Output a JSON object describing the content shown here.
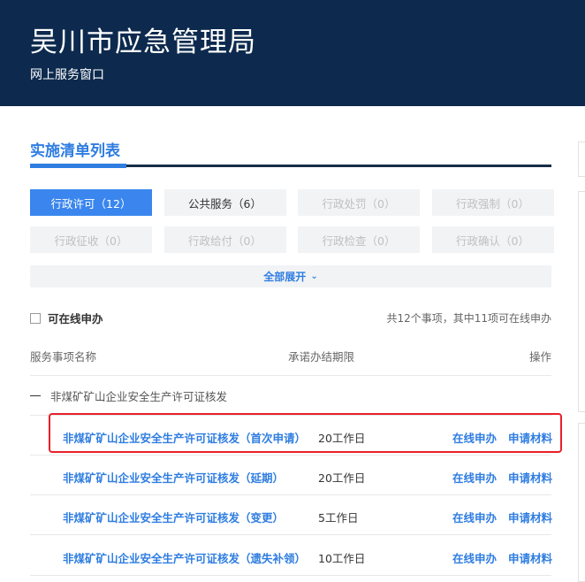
{
  "header": {
    "title": "吴川市应急管理局",
    "subtitle": "网上服务窗口",
    "bg_color": "#0d2a4e"
  },
  "section": {
    "title": "实施清单列表",
    "accent_color": "#2f7de1"
  },
  "categories": [
    {
      "label": "行政许可（12）",
      "state": "active"
    },
    {
      "label": "公共服务（6）",
      "state": "enabled"
    },
    {
      "label": "行政处罚（0）",
      "state": "disabled"
    },
    {
      "label": "行政强制（0）",
      "state": "disabled"
    },
    {
      "label": "行政征收（0）",
      "state": "disabled"
    },
    {
      "label": "行政给付（0）",
      "state": "disabled"
    },
    {
      "label": "行政检查（0）",
      "state": "disabled"
    },
    {
      "label": "行政确认（0）",
      "state": "disabled"
    }
  ],
  "expand": {
    "label": "全部展开",
    "icon": "chevron-down-icon"
  },
  "filter": {
    "label": "可在线申办",
    "checked": false
  },
  "summary": "共12个事项，其中11项可在线申办",
  "table": {
    "headers": {
      "name": "服务事项名称",
      "time": "承诺办结期限",
      "op": "操作"
    },
    "group": "非煤矿矿山企业安全生产许可证核发",
    "rows": [
      {
        "name": "非煤矿矿山企业安全生产许可证核发（首次申请）",
        "time": "20工作日",
        "online": "在线申办",
        "materials": "申请材料"
      },
      {
        "name": "非煤矿矿山企业安全生产许可证核发（延期）",
        "time": "20工作日",
        "online": "在线申办",
        "materials": "申请材料"
      },
      {
        "name": "非煤矿矿山企业安全生产许可证核发（变更）",
        "time": "5工作日",
        "online": "在线申办",
        "materials": "申请材料"
      },
      {
        "name": "非煤矿矿山企业安全生产许可证核发（遗失补领）",
        "time": "10工作日",
        "online": "在线申办",
        "materials": "申请材料"
      }
    ]
  },
  "highlight_color": "#e8202a"
}
